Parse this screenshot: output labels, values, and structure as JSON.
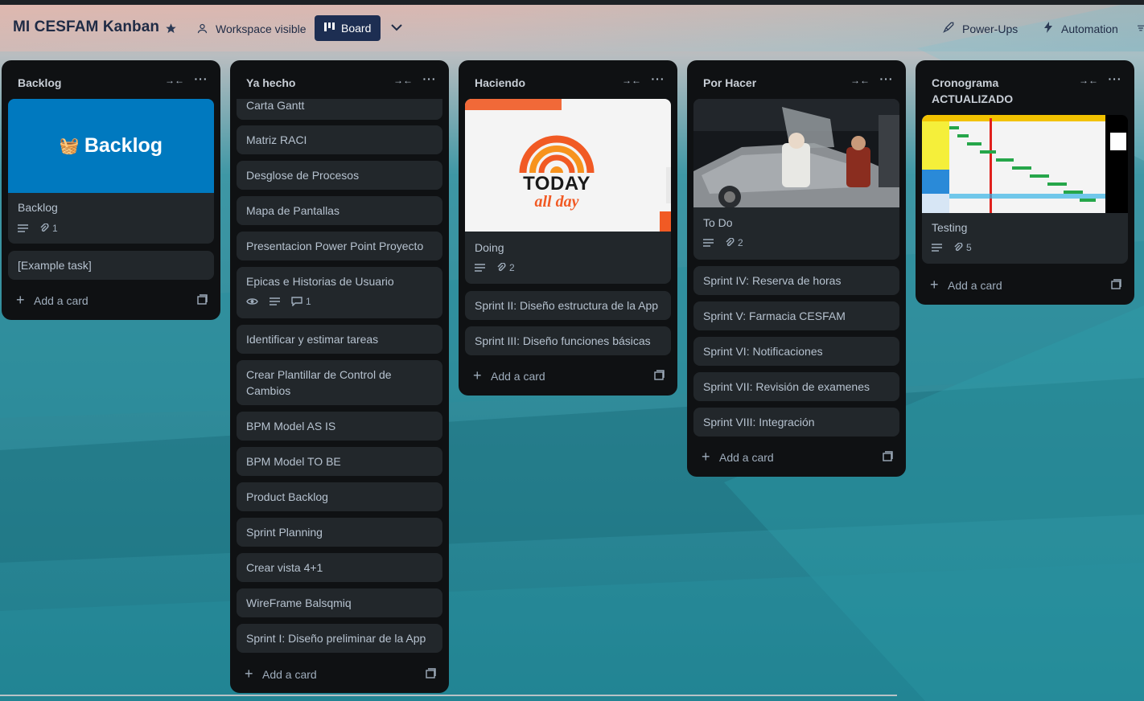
{
  "header": {
    "board_title": "MI CESFAM Kanban",
    "visibility_label": "Workspace visible",
    "view_label": "Board",
    "powerups_label": "Power-Ups",
    "automation_label": "Automation"
  },
  "add_card_label": "Add a card",
  "lists": [
    {
      "title": "Backlog",
      "cards": [
        {
          "title": "Backlog",
          "cover_text": "Backlog",
          "description": true,
          "attachments": "1"
        },
        {
          "title": "[Example task]"
        }
      ]
    },
    {
      "title": "Ya hecho",
      "cards": [
        {
          "title": "Carta Gantt"
        },
        {
          "title": "Matriz RACI"
        },
        {
          "title": "Desglose de Procesos"
        },
        {
          "title": "Mapa de Pantallas"
        },
        {
          "title": "Presentacion Power Point Proyecto"
        },
        {
          "title": "Epicas e Historias de Usuario",
          "watching": true,
          "description": true,
          "comments": "1"
        },
        {
          "title": "Identificar y estimar tareas"
        },
        {
          "title": "Crear Plantillar de Control de Cambios"
        },
        {
          "title": "BPM Model AS IS"
        },
        {
          "title": "BPM Model TO BE"
        },
        {
          "title": "Product Backlog"
        },
        {
          "title": "Sprint Planning"
        },
        {
          "title": "Crear vista 4+1"
        },
        {
          "title": "WireFrame Balsqmiq"
        },
        {
          "title": "Sprint I: Diseño preliminar de la App"
        }
      ]
    },
    {
      "title": "Haciendo",
      "cards": [
        {
          "title": "Doing",
          "cover_text_1": "TODAY",
          "cover_text_2": "all day",
          "description": true,
          "attachments": "2"
        },
        {
          "title": "Sprint II: Diseño estructura de la App"
        },
        {
          "title": "Sprint III: Diseño funciones básicas"
        }
      ]
    },
    {
      "title": "Por Hacer",
      "cards": [
        {
          "title": "To Do",
          "description": true,
          "attachments": "2"
        },
        {
          "title": "Sprint IV: Reserva de horas"
        },
        {
          "title": "Sprint V: Farmacia CESFAM"
        },
        {
          "title": "Sprint VI: Notificaciones"
        },
        {
          "title": "Sprint VII: Revisión de examenes"
        },
        {
          "title": "Sprint VIII: Integración"
        }
      ]
    },
    {
      "title": "Cronograma ACTUALIZADO",
      "cards": [
        {
          "title": "Testing",
          "description": true,
          "attachments": "5"
        }
      ]
    }
  ],
  "colors": {
    "list_bg": "#0f1113",
    "card_bg": "#22272b",
    "card_text": "#b6c2cf",
    "board_button_bg": "#1d2e52",
    "backlog_cover": "#0079bf",
    "today_orange": "#f15a24"
  },
  "icons": [
    "star-icon",
    "people-icon",
    "board-icon",
    "chevron-down-icon",
    "rocket-icon",
    "lightning-icon",
    "collapse-icon",
    "more-icon",
    "description-icon",
    "attachment-icon",
    "eye-icon",
    "comment-icon",
    "plus-icon",
    "template-icon"
  ]
}
